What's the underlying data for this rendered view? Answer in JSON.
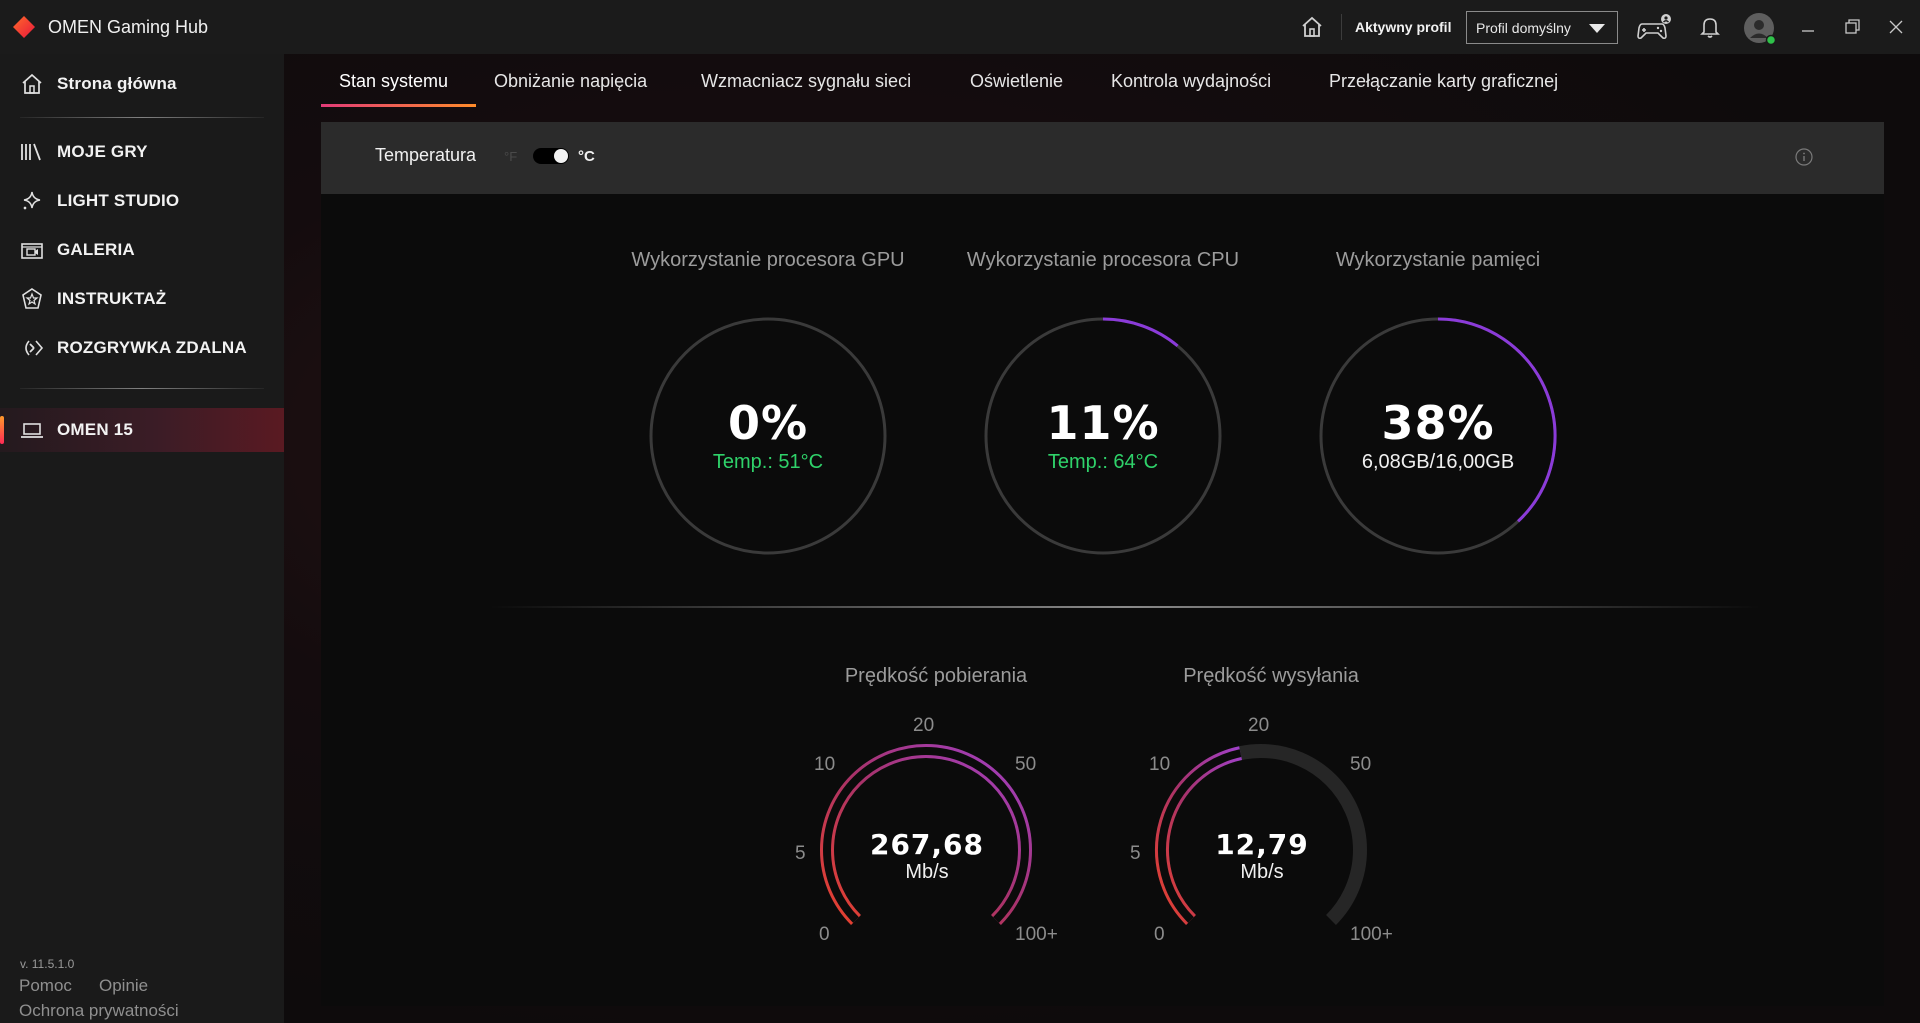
{
  "app": {
    "title": "OMEN Gaming Hub"
  },
  "titlebar": {
    "active_profile_label": "Aktywny profil",
    "profile_select_value": "Profil domyślny"
  },
  "sidebar": {
    "home": "Strona główna",
    "items": [
      {
        "label": "MOJE GRY",
        "icon": "library-icon"
      },
      {
        "label": "LIGHT STUDIO",
        "icon": "sparkle-icon"
      },
      {
        "label": "GALERIA",
        "icon": "gallery-icon"
      },
      {
        "label": "INSTRUKTAŻ",
        "icon": "coach-icon"
      },
      {
        "label": "ROZGRYWKA ZDALNA",
        "icon": "remote-play-icon"
      }
    ],
    "device": "OMEN 15",
    "version": "v. 11.5.1.0",
    "help": "Pomoc",
    "feedback": "Opinie",
    "privacy": "Ochrona prywatności"
  },
  "tabs": [
    "Stan systemu",
    "Obniżanie napięcia",
    "Wzmacniacz sygnału sieci",
    "Oświetlenie",
    "Kontrola wydajności",
    "Przełączanie karty graficznej"
  ],
  "temperature": {
    "label": "Temperatura",
    "unit_f": "°F",
    "unit_c": "°C",
    "celsius_selected": true
  },
  "stats": {
    "gpu": {
      "title": "Wykorzystanie procesora GPU",
      "value": "0%",
      "sub": "Temp.: 51°C",
      "percent": 0
    },
    "cpu": {
      "title": "Wykorzystanie procesora CPU",
      "value": "11%",
      "sub": "Temp.: 64°C",
      "percent": 11
    },
    "mem": {
      "title": "Wykorzystanie pamięci",
      "value": "38%",
      "sub": "6,08GB/16,00GB",
      "percent": 38
    }
  },
  "network": {
    "download": {
      "title": "Prędkość pobierania",
      "value": "267,68",
      "unit": "Mb/s"
    },
    "upload": {
      "title": "Prędkość wysyłania",
      "value": "12,79",
      "unit": "Mb/s"
    },
    "ticks": [
      "0",
      "5",
      "10",
      "20",
      "50",
      "100+"
    ]
  },
  "colors": {
    "accent_start": "#ff8c2a",
    "accent_end": "#e23b78",
    "ring_progress": "#8b3bd9",
    "temp_green": "#2fd26a"
  }
}
